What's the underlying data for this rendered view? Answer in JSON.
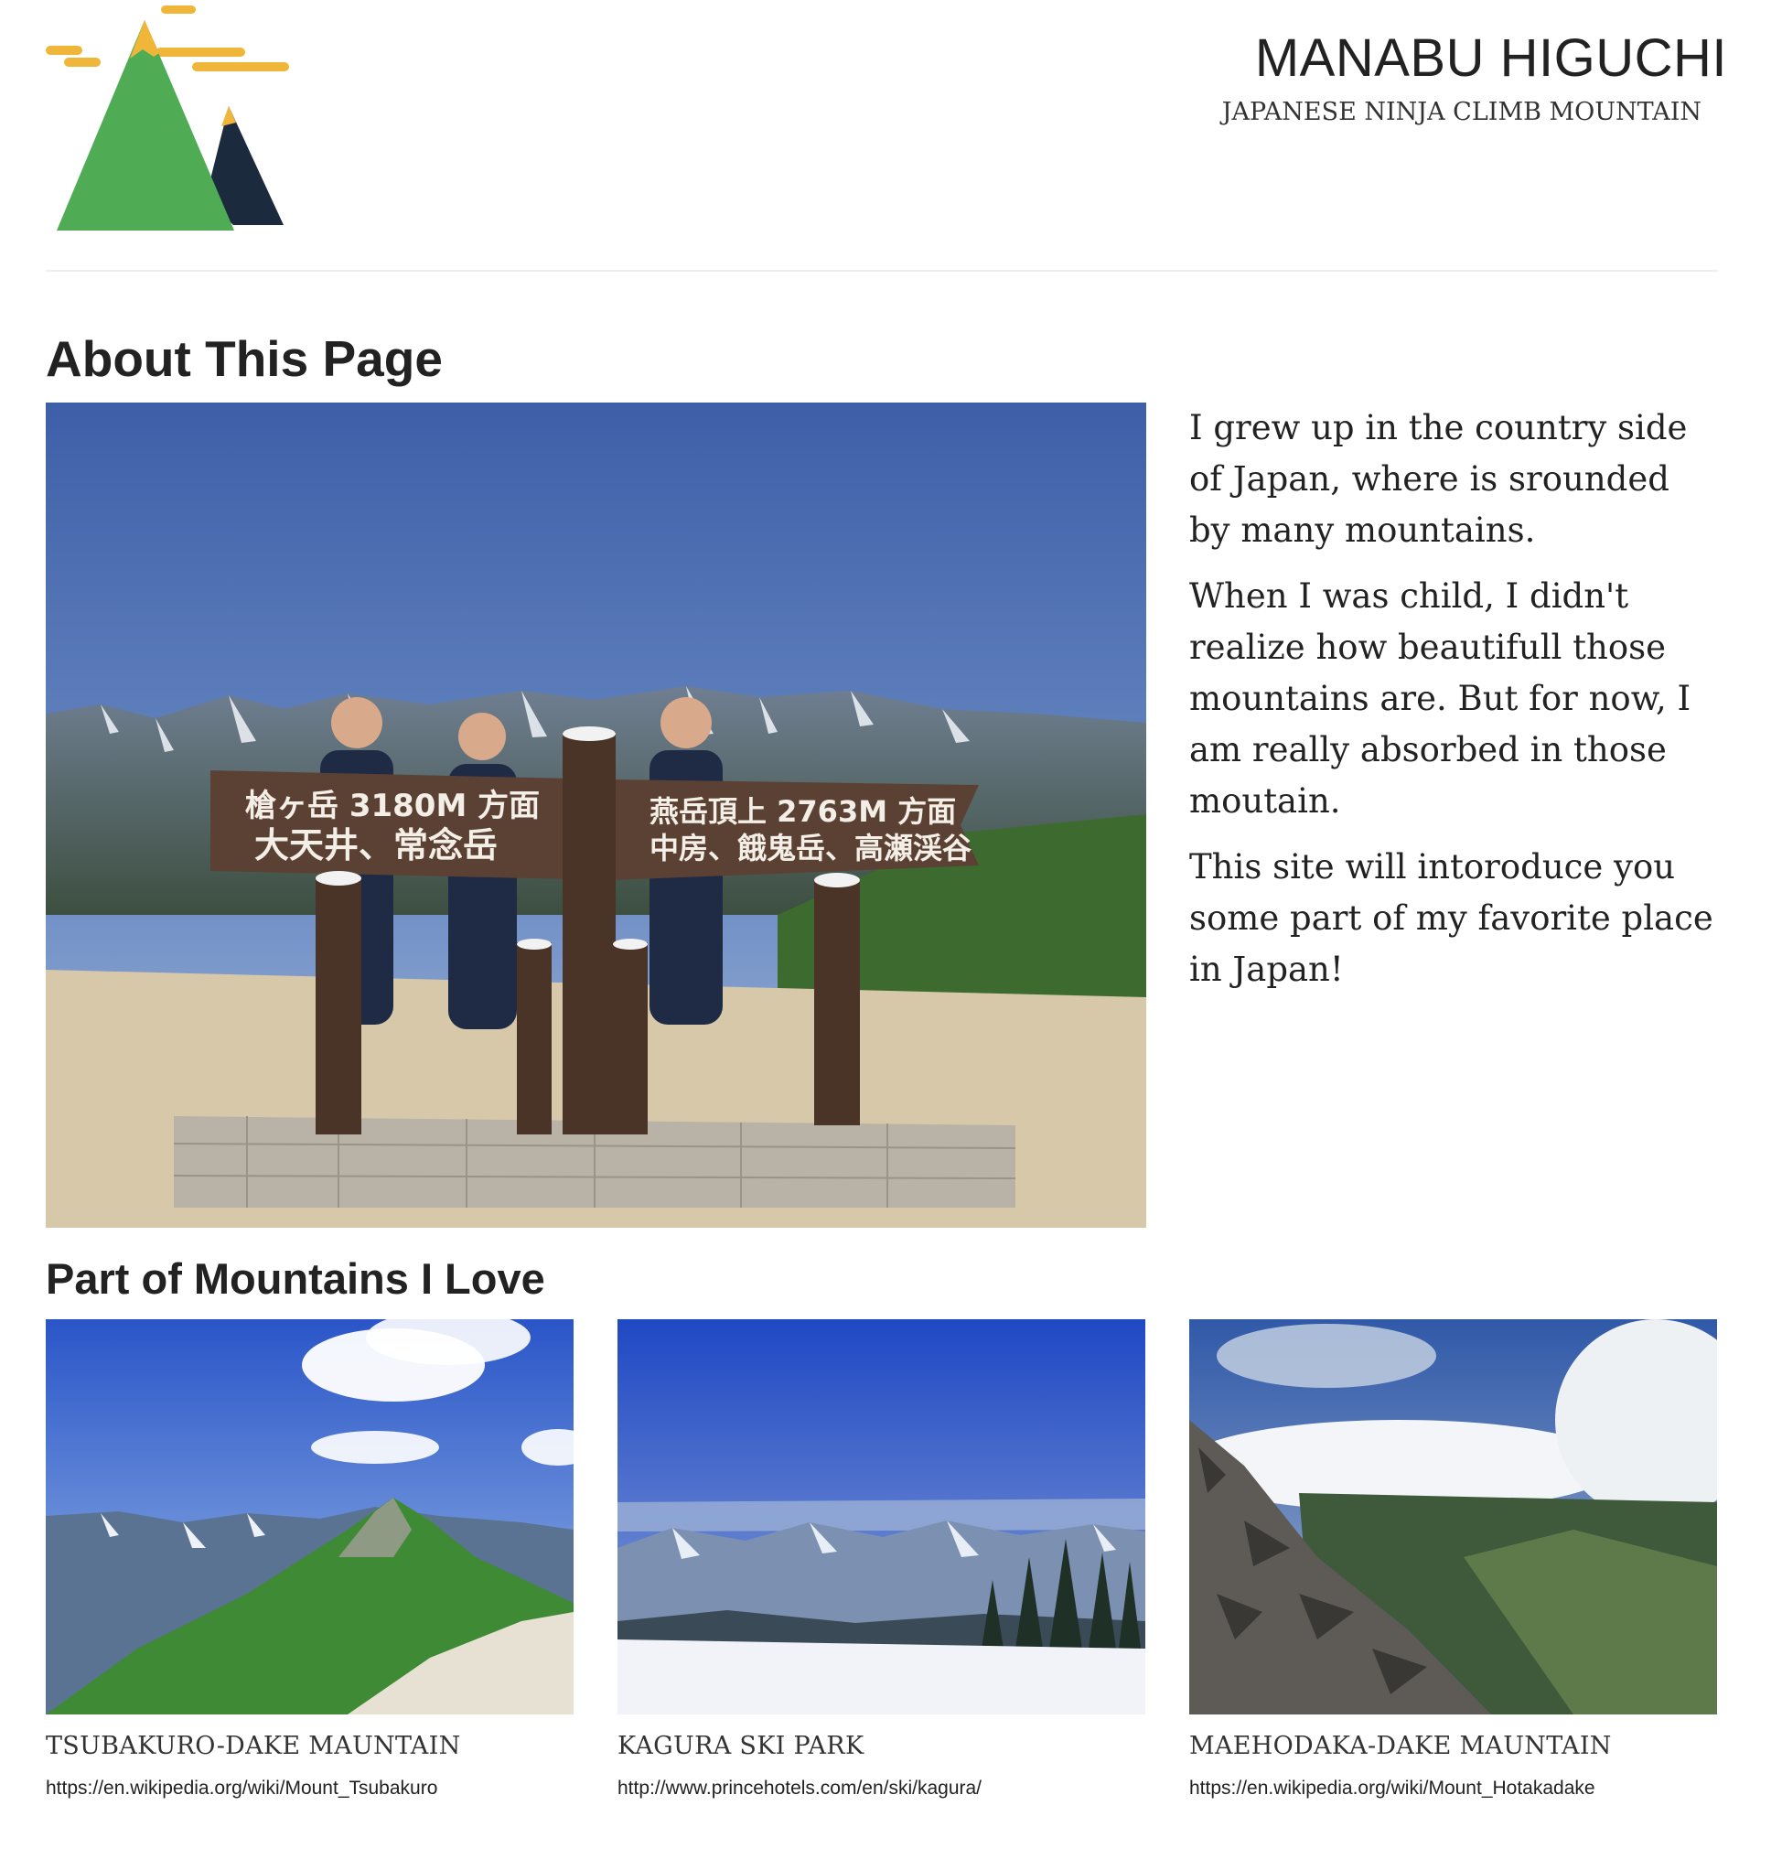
{
  "header": {
    "name": "MANABU HIGUCHI",
    "tagline": "JAPANESE NINJA CLIMB MOUNTAIN",
    "logo_icon": "mountain-logo-icon"
  },
  "about": {
    "title": "About This Page",
    "paragraphs": [
      "I grew up in the country side of Japan, where is srounded by many mountains.",
      "When I was child, I didn't realize how beautifull those mountains are. But for now, I am really absorbed in those moutain.",
      "This site will intoroduce you some part of my favorite place in Japan!"
    ],
    "sign_left": {
      "line1": "槍ヶ岳 3180M 方面",
      "line2": "大天井、常念岳"
    },
    "sign_right": {
      "line1": "燕岳頂上 2763M 方面",
      "line2": "中房、餓鬼岳、高瀬渓谷"
    }
  },
  "mountains": {
    "title": "Part of Mountains I Love",
    "cards": [
      {
        "name": "TSUBAKURO-DAKE MAUNTAIN",
        "url": "https://en.wikipedia.org/wiki/Mount_Tsubakuro"
      },
      {
        "name": "KAGURA SKI PARK",
        "url": "http://www.princehotels.com/en/ski/kagura/"
      },
      {
        "name": "MAEHODAKA-DAKE MAUNTAIN",
        "url": "https://en.wikipedia.org/wiki/Mount_Hotakadake"
      }
    ]
  },
  "colors": {
    "logo_green": "#4fac55",
    "logo_navy": "#1b2a3d",
    "logo_gold": "#f0b63a"
  }
}
